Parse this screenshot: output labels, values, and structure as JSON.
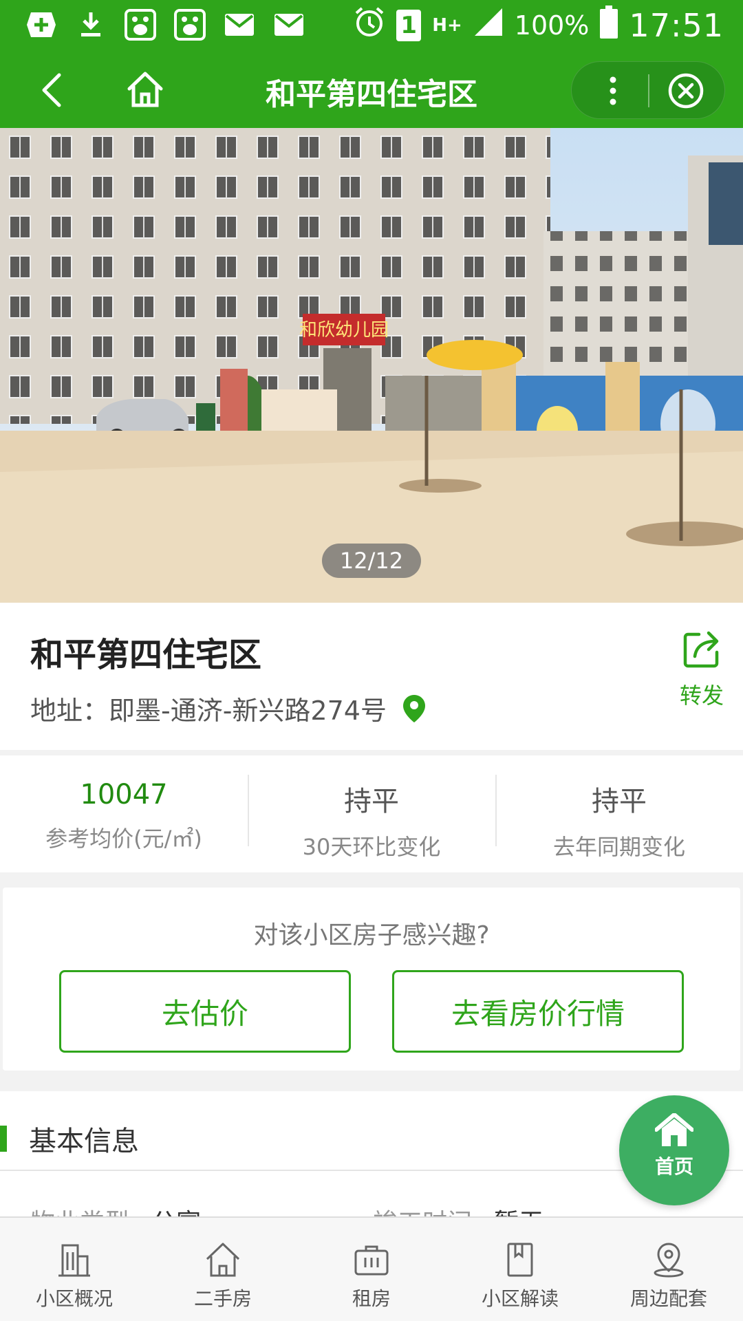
{
  "status_bar": {
    "left_icons": [
      "plus-square-icon",
      "download-icon",
      "baidu-icon",
      "baidu-icon",
      "mail-icon",
      "mail-icon"
    ],
    "sim_badge": "1",
    "network": "H+",
    "battery_percent": "100%",
    "time": "17:51"
  },
  "nav": {
    "title": "和平第四住宅区"
  },
  "gallery": {
    "counter": "12/12",
    "sign_text": "和欣幼儿园"
  },
  "community": {
    "name": "和平第四住宅区",
    "address": "地址：即墨-通济-新兴路274号",
    "share_label": "转发"
  },
  "stats": [
    {
      "value": "10047",
      "label": "参考均价(元/㎡)"
    },
    {
      "value": "持平",
      "label": "30天环比变化"
    },
    {
      "value": "持平",
      "label": "去年同期变化"
    }
  ],
  "interest": {
    "question": "对该小区房子感兴趣?",
    "estimate_button": "去估价",
    "trend_button": "去看房价行情"
  },
  "basic_info": {
    "title": "基本信息",
    "property_type_label": "物业类型:",
    "property_type_value": "公寓",
    "completion_label": "竣工时间:",
    "completion_value": "暂无"
  },
  "fab": {
    "label": "首页"
  },
  "tabs": [
    {
      "label": "小区概况",
      "icon": "building-icon"
    },
    {
      "label": "二手房",
      "icon": "house-icon"
    },
    {
      "label": "租房",
      "icon": "briefcase-icon"
    },
    {
      "label": "小区解读",
      "icon": "book-icon"
    },
    {
      "label": "周边配套",
      "icon": "location-icon"
    }
  ],
  "colors": {
    "brand_green": "#2fa51b",
    "price_green": "#218b10",
    "fab_green": "#3dae62"
  }
}
